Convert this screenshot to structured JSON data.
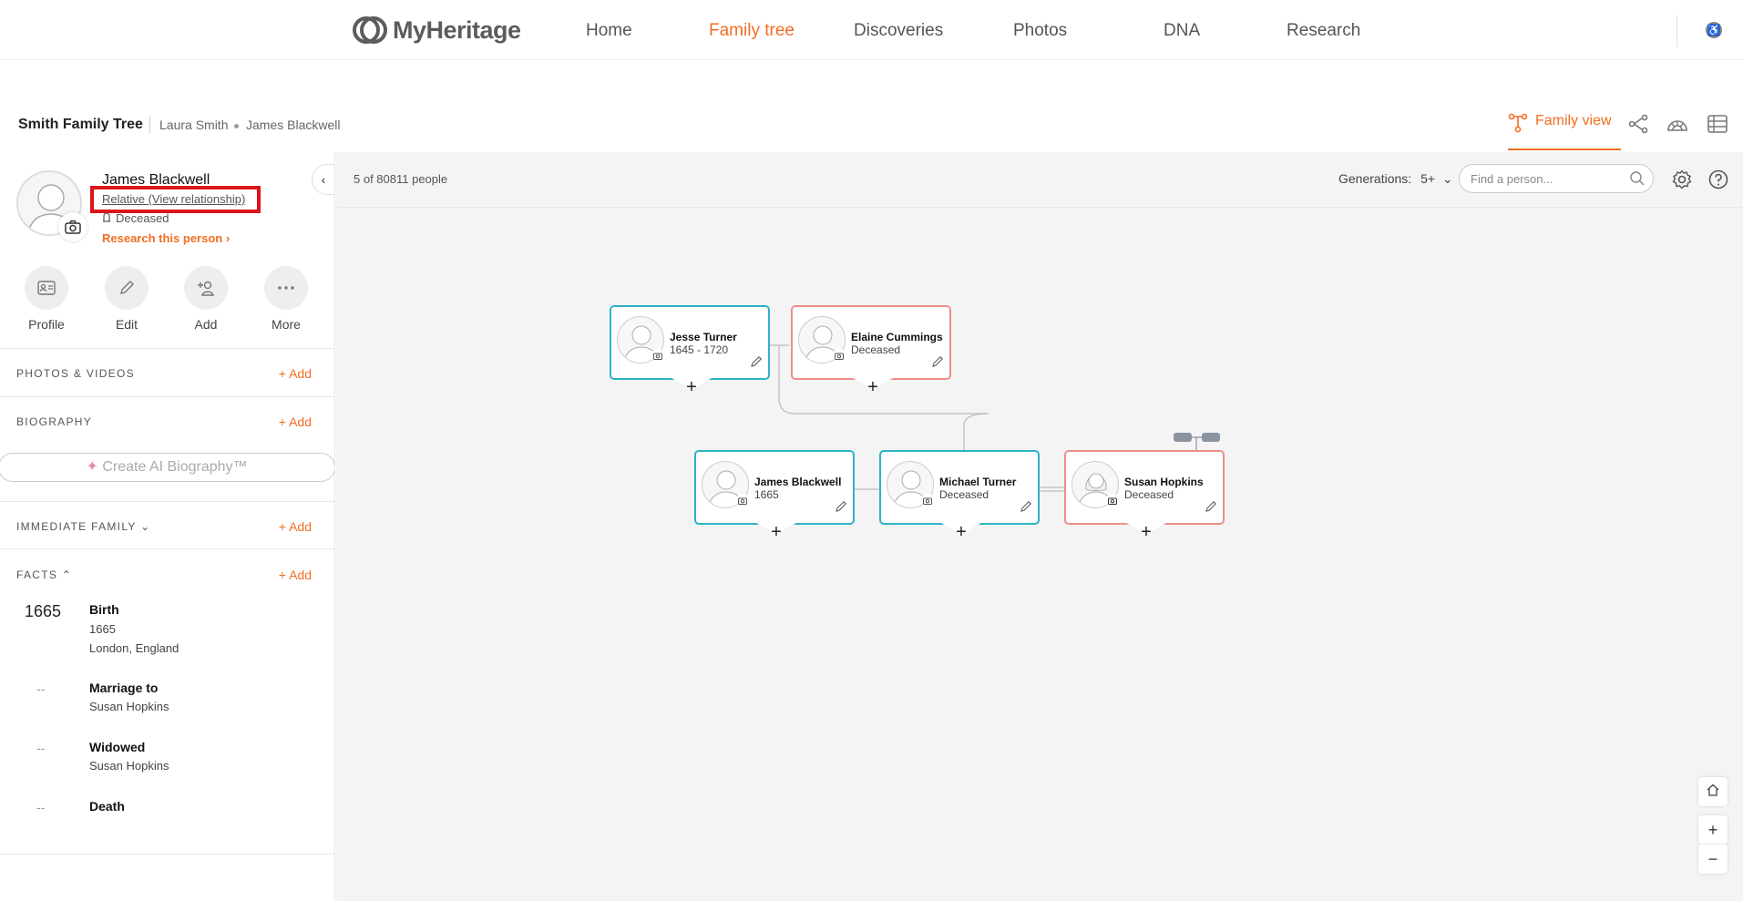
{
  "nav": {
    "logo": "MyHeritage",
    "items": [
      {
        "label": "Home"
      },
      {
        "label": "Family tree"
      },
      {
        "label": "Discoveries"
      },
      {
        "label": "Photos"
      },
      {
        "label": "DNA"
      },
      {
        "label": "Research"
      }
    ],
    "active_item": "Family tree",
    "accent_color": "#f26e22"
  },
  "header": {
    "tree_title": "Smith Family Tree",
    "breadcrumb": [
      "Laura Smith",
      "James Blackwell"
    ],
    "view_tab": "Family view"
  },
  "person": {
    "name": "James Blackwell",
    "relationship_link": "Relative (View relationship)",
    "status": "Deceased",
    "research_link": "Research this person",
    "actions": [
      {
        "label": "Profile",
        "icon": "profile-card-icon"
      },
      {
        "label": "Edit",
        "icon": "pencil-icon"
      },
      {
        "label": "Add",
        "icon": "add-person-icon"
      },
      {
        "label": "More",
        "icon": "more-dots-icon"
      }
    ]
  },
  "sections": {
    "photos_title": "PHOTOS & VIDEOS",
    "biography_title": "BIOGRAPHY",
    "ai_biography": "Create AI Biography™",
    "immediate_family_title": "IMMEDIATE FAMILY",
    "facts_title": "FACTS",
    "add_label": "+ Add"
  },
  "facts": [
    {
      "year": "1665",
      "title": "Birth",
      "lines": [
        "1665",
        "London, England"
      ]
    },
    {
      "year": "--",
      "title": "Marriage to",
      "lines": [
        "Susan Hopkins"
      ]
    },
    {
      "year": "--",
      "title": "Widowed",
      "lines": [
        "Susan Hopkins"
      ]
    },
    {
      "year": "--",
      "title": "Death",
      "lines": []
    }
  ],
  "canvas": {
    "count": "5 of 80811 people",
    "generations_label": "Generations:",
    "generations_value": "5+",
    "find_placeholder": "Find a person..."
  },
  "tree": {
    "people": [
      {
        "name": "Jesse Turner",
        "dates": "1645 - 1720",
        "gender": "male"
      },
      {
        "name": "Elaine Cummings",
        "dates": "Deceased",
        "gender": "female"
      },
      {
        "name": "James Blackwell",
        "dates": "1665",
        "gender": "male"
      },
      {
        "name": "Michael Turner",
        "dates": "Deceased",
        "gender": "male"
      },
      {
        "name": "Susan Hopkins",
        "dates": "Deceased",
        "gender": "female"
      }
    ],
    "male_color": "#2eb2c8",
    "female_color": "#ef8d8b"
  }
}
